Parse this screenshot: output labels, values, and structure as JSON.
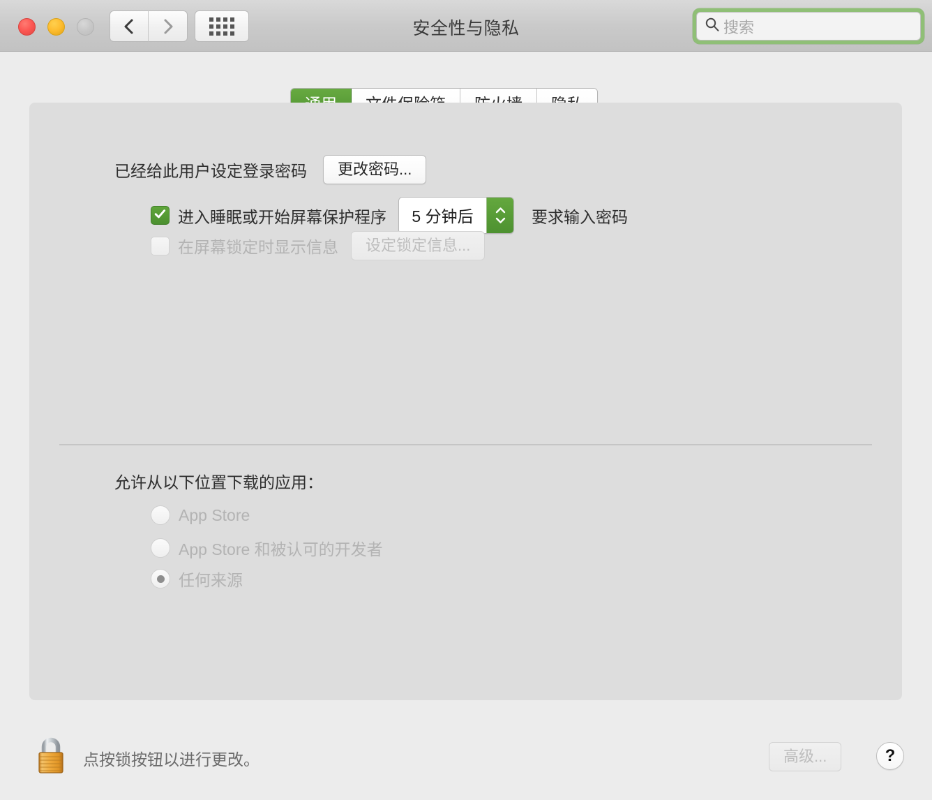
{
  "window": {
    "title": "安全性与隐私",
    "traffic_lights": [
      "close",
      "minimize",
      "zoom"
    ],
    "colors": {
      "accent_green": "#4e9130",
      "focus_ring_green": "#8fbf76",
      "toolbar_bg": "#cacaca",
      "pane_bg": "#dddddd",
      "body_bg": "#ececec",
      "lock_gold": "#e8a33a"
    }
  },
  "toolbar": {
    "back_label": "后退",
    "forward_label": "前进",
    "show_all_label": "显示全部",
    "search": {
      "placeholder": "搜索",
      "value": "",
      "focused": true
    }
  },
  "tabs": [
    {
      "label": "通用",
      "active": true
    },
    {
      "label": "文件保险箱",
      "active": false
    },
    {
      "label": "防火墙",
      "active": false
    },
    {
      "label": "隐私",
      "active": false
    }
  ],
  "general": {
    "password_status": "已经给此用户设定登录密码",
    "change_password_button": "更改密码...",
    "require_password": {
      "checked": true,
      "enabled": true,
      "label_before": "进入睡眠或开始屏幕保护程序",
      "delay_value": "5 分钟后",
      "label_after": "要求输入密码"
    },
    "lock_message": {
      "checked": false,
      "enabled": false,
      "label": "在屏幕锁定时显示信息",
      "button": "设定锁定信息..."
    },
    "downloads": {
      "heading": "允许从以下位置下载的应用：",
      "enabled": false,
      "options": [
        {
          "label": "App Store",
          "selected": false
        },
        {
          "label": "App Store 和被认可的开发者",
          "selected": false
        },
        {
          "label": "任何来源",
          "selected": true
        }
      ]
    }
  },
  "bottom": {
    "lock_state": "locked",
    "lock_note": "点按锁按钮以进行更改。",
    "advanced_button": "高级...",
    "advanced_enabled": false,
    "help_label": "?"
  }
}
